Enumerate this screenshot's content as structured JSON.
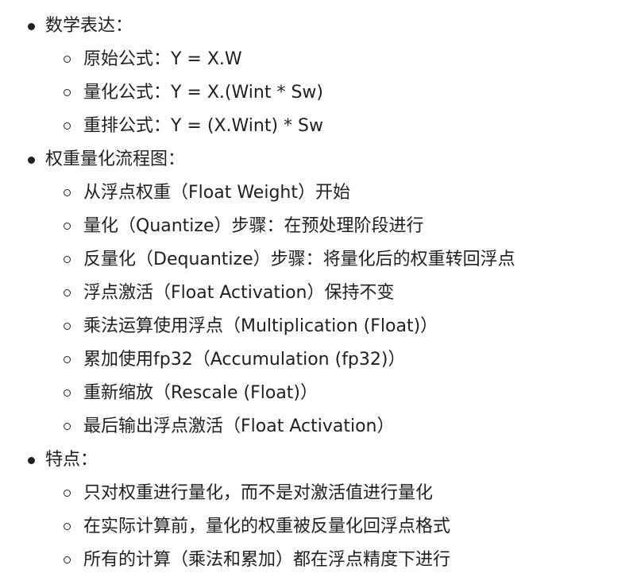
{
  "sections": [
    {
      "label": "数学表达：",
      "items": [
        "原始公式：Y = X.W",
        "量化公式：Y = X.(Wint * Sw)",
        "重排公式：Y = (X.Wint) * Sw"
      ]
    },
    {
      "label": "权重量化流程图：",
      "items": [
        "从浮点权重（Float Weight）开始",
        "量化（Quantize）步骤：在预处理阶段进行",
        "反量化（Dequantize）步骤：将量化后的权重转回浮点",
        "浮点激活（Float Activation）保持不变",
        "乘法运算使用浮点（Multiplication (Float)）",
        "累加使用fp32（Accumulation (fp32)）",
        "重新缩放（Rescale (Float)）",
        "最后输出浮点激活（Float Activation）"
      ]
    },
    {
      "label": "特点：",
      "items": [
        "只对权重进行量化，而不是对激活值进行量化",
        "在实际计算前，量化的权重被反量化回浮点格式",
        "所有的计算（乘法和累加）都在浮点精度下进行"
      ]
    }
  ]
}
